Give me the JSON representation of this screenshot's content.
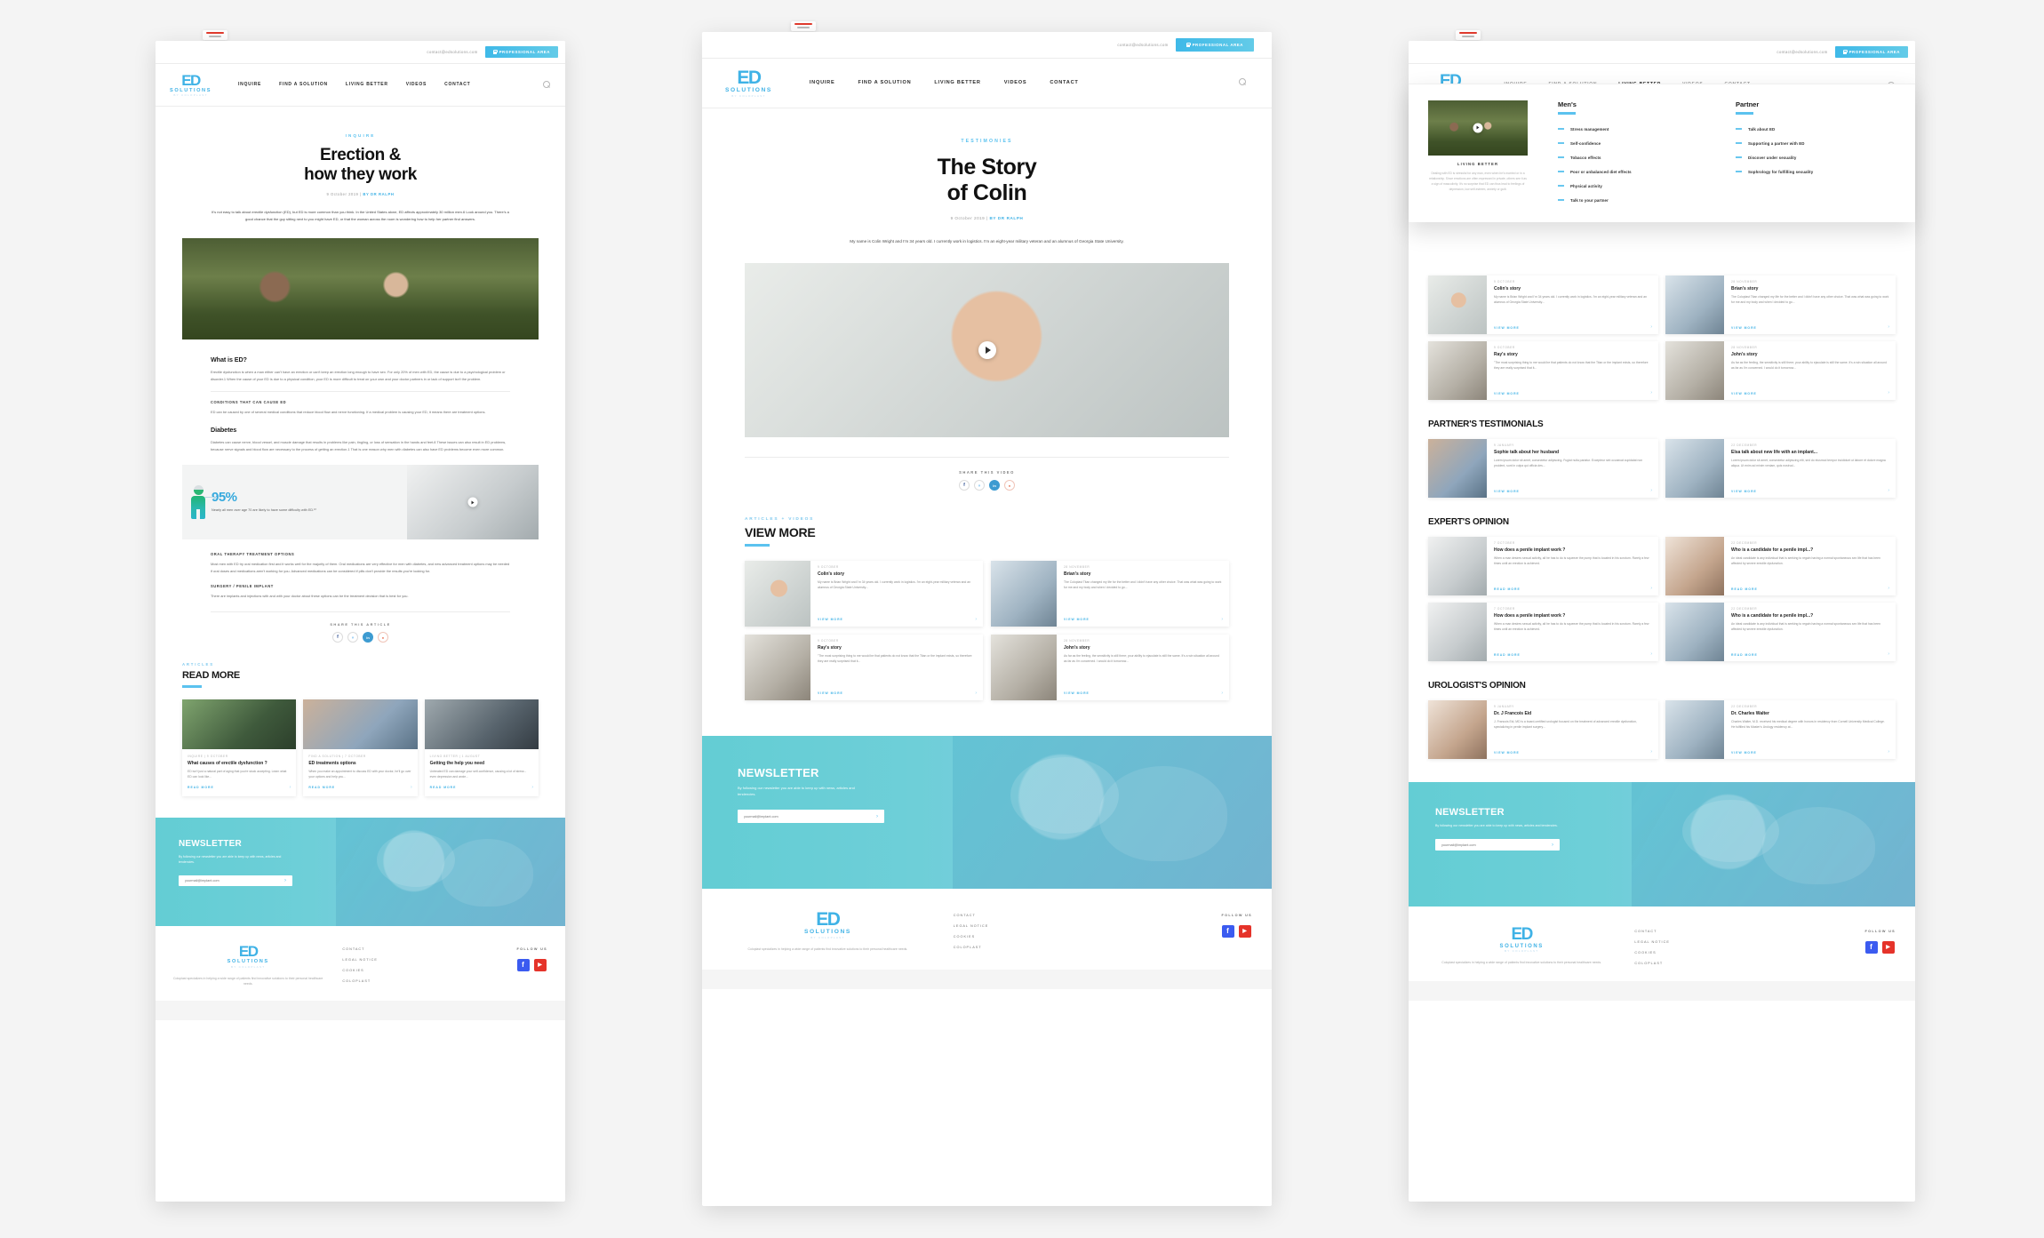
{
  "brand": {
    "mark": "ED",
    "name": "SOLUTIONS",
    "byline": "BY COLOPLAST"
  },
  "topbar": {
    "email": "contact@edsolutions.com",
    "pro_area": "PROFESSIONAL AREA"
  },
  "nav": {
    "items": [
      {
        "label": "INQUIRE"
      },
      {
        "label": "FIND A SOLUTION"
      },
      {
        "label": "LIVING BETTER"
      },
      {
        "label": "VIDEOS"
      },
      {
        "label": "CONTACT"
      }
    ],
    "search_icon": "search-icon"
  },
  "page1": {
    "eyebrow": "INQUIRE",
    "title_line1": "Erection &",
    "title_line2": "how they work",
    "date": "9 October 2019",
    "author": "BY DR RALPH",
    "lead": "It's not easy to talk about erectile dysfunction (ED), but ED is more common than you think. In the United States alone, ED affects approximately 30 million men.6 Look around you. There's a good chance that the guy sitting next to you might have ED, or that the woman across the room is wondering how to help her partner find answers.",
    "s1_title": "What is ED?",
    "s1_body": "Erectile dysfunction is when a man either can't have an erection or can't keep an erection long enough to have sex. For only 20% of men with ED, the cause is due to a psychological problem or disorder.1 When the cause of your ED is due to a physical condition, your ED is more difficult to treat on your own and your doctor partners in or lack of support isn't the problem.",
    "s2_title": "CONDITIONS THAT CAN CAUSE ED",
    "s2_body": "ED can be caused by one of several medical conditions that reduce blood flow and nerve functioning. If a medical problem is causing your ED, it means there are treatment options.",
    "s3_title": "Diabetes",
    "s3_body": "Diabetes can cause nerve, blood vessel, and muscle damage that results in problems like pain, tingling, or loss of sensation in the hands and feet.8 These issues can also result in ED problems, because nerve signals and blood flow are necessary to the process of getting an erection.1 That is one reason why men with diabetes can also have ED problems become even more common.",
    "stat_number": "95%",
    "stat_caption": "Nearly all men over age 70 are likely to have some difficulty with ED.¹⁰",
    "s4_title": "ORAL THERAPY TREATMENT OPTIONS",
    "s4_body": "Most men with ED try oral medication first and it works well for the majority of them. Oral medications are very effective for men with diabetes, and new advanced treatment options may be needed if oral doses and medications aren't working for you. Advanced medications can be considered if pills don't provide the results you're looking for.",
    "s5_title": "SURGERY / PENILE IMPLANT",
    "s5_body": "There are implants and injections with and with your doctor about these options can be the treatment decision that is best for you.",
    "share_label": "SHARE THIS ARTICLE",
    "more_eyebrow": "ARTICLES",
    "more_title": "READ MORE",
    "cards": [
      {
        "meta": "INQUIRE  |  9 OCTOBER",
        "title": "What  causes of erectile dysfunction ?",
        "desc": "ED isn't just a natural part of aging that you're stuck accepting. Learn what ED can look like...",
        "link": "READ MORE",
        "thumb": "couple1"
      },
      {
        "meta": "FIND A SOLUTION  |  7 OCTOBER",
        "title": "ED treatments options",
        "desc": "When you make an appointment to discuss ED with your doctor, he'll go over your options and help you...",
        "link": "READ MORE",
        "thumb": "couple2"
      },
      {
        "meta": "LIVING BETTER  |  1 AUGUST",
        "title": "Getting the help you need",
        "desc": "Untreated ED can damage your self-confidence, causing a lot of stress - even depression and anxie...",
        "link": "READ MORE",
        "thumb": "couple3"
      }
    ]
  },
  "page2": {
    "eyebrow": "TESTIMONIES",
    "title_line1": "The Story",
    "title_line2": "of Colin",
    "date": "9 October 2019",
    "author": "BY DR RALPH",
    "lead": "My name is Colin Wright and I'm 34 years old. I currently work in logistics. I'm an eight-year military veteran and an alumnus of Georgia State University.",
    "share_label": "SHARE THIS VIDEO",
    "more_eyebrow": "ARTICLES + VIDEOS",
    "more_title": "VIEW MORE",
    "cards": [
      {
        "meta": "9 OCTOBER",
        "title": "Colin's story",
        "desc": "My name is Brian Wright and I'm 34 years old. I currently work in logistics. I'm an eight-year military veteran and an alumnus of Georgia State University...",
        "link": "VIEW MORE",
        "thumb": "portrait"
      },
      {
        "meta": "28 NOVEMBER",
        "title": "Brian's story",
        "desc": "The Coloplast Titan changed my life for the better and I didn't have any other choice. That was what was going to work for me and my body and when I decided to go...",
        "link": "VIEW MORE",
        "thumb": "senior-b"
      },
      {
        "meta": "9 OCTOBER",
        "title": "Ray's story",
        "desc": "\"The most surprising thing to me would be that patients do not know that the Titan or the implant exists, so therefore they are really surprised that it...",
        "link": "VIEW MORE",
        "thumb": "senior-a"
      },
      {
        "meta": "28 NOVEMBER",
        "title": "John's story",
        "desc": "As far as the feeling, the sensitivity is still there; your ability to ejaculate is still the same. It's a win situation all around as far as I'm concerned. I would do it tomorrow...",
        "link": "VIEW MORE",
        "thumb": "senior-a"
      }
    ]
  },
  "page3": {
    "megamenu": {
      "feature_caption": "LIVING BETTER",
      "feature_desc": "Dealing with ED is stressful for any man, even when he's married or in a relationship. Since emotions are often expressed in private, others see it as a sign of masculinity. It's no surprise that ED can thus lead to feelings of depression, low self-esteem, anxiety or guilt.",
      "columns": [
        {
          "title": "Men's",
          "items": [
            "Stress management",
            "Self-confidence",
            "Tobacco effects",
            "Poor or unbalanced diet effects",
            "Physical activity",
            "Talk to your partner"
          ]
        },
        {
          "title": "Partner",
          "items": [
            "Talk about ED",
            "Supporting a partner with ED",
            "Discover under sexuality",
            "Sophrology for fulfilling sexuality"
          ]
        }
      ]
    },
    "mens_cards": [
      {
        "meta": "9 OCTOBER",
        "title": "Colin's story",
        "desc": "My name is Brian Wright and I'm 34 years old. I currently work in logistics. I'm an eight-year military veteran and an alumnus of Georgia State University...",
        "link": "VIEW MORE",
        "thumb": "portrait"
      },
      {
        "meta": "28 NOVEMBER",
        "title": "Brian's story",
        "desc": "The Coloplast Titan changed my life for the better and I didn't have any other choice. That was what was going to work for me and my body and when I decided to go...",
        "link": "VIEW MORE",
        "thumb": "senior-b"
      },
      {
        "meta": "9 OCTOBER",
        "title": "Ray's story",
        "desc": "\"The most surprising thing to me would be that patients do not know that the Titan or the implant exists, so therefore they are really surprised that it...",
        "link": "VIEW MORE",
        "thumb": "senior-a"
      },
      {
        "meta": "28 NOVEMBER",
        "title": "John's story",
        "desc": "As far as the feeling, the sensitivity is still there; your ability to ejaculate is still the same. It's a win situation all around as far as I'm concerned. I would do it tomorrow...",
        "link": "VIEW MORE",
        "thumb": "senior-a"
      }
    ],
    "partners_title": "PARTNER'S TESTIMONIALS",
    "partners_cards": [
      {
        "meta": "9 JANUARY",
        "title": "Sophie talk about her husband",
        "desc": "Lorem ipsum dolor sit amet, consectetur adipiscing. Fugiat nulla pariatur. Excepteur sint occaecat cupidatat non proident, sunt in culpa qui officia des...",
        "link": "VIEW MORE",
        "thumb": "couple2"
      },
      {
        "meta": "22 DECEMBER",
        "title": "Elsa talk about new life with an implant...",
        "desc": "Lorem ipsum dolor sit amet, consectetur adipiscing elit, sed do eiusmod tempor incididunt ut labore et dolore magna aliqua. Ut enim ad minim veniam, quis nostrud...",
        "link": "VIEW MORE",
        "thumb": "senior-b"
      }
    ],
    "experts_title": "EXPERT'S OPINION",
    "experts_cards": [
      {
        "meta": "7 OCTOBER",
        "title": "How does a penile implant work ?",
        "desc": "When a man desires sexual activity, all he has to do is squeeze the pump that is located in his scrotum. Rarely a few times until an erection is achieved.",
        "link": "READ MORE",
        "thumb": "office"
      },
      {
        "meta": "22 DECEMBER",
        "title": "Who is a candidate for a penile impl...?",
        "desc": "An ideal candidate is any individual that is seeking to regain having a normal spontaneous sex life that has been affected by severe erectile dysfunction.",
        "link": "READ MORE",
        "thumb": "woman"
      },
      {
        "meta": "7 OCTOBER",
        "title": "How does a penile implant work ?",
        "desc": "When a man desires sexual activity, all he has to do is squeeze the pump that is located in his scrotum. Rarely a few times until an erection is achieved.",
        "link": "READ MORE",
        "thumb": "office"
      },
      {
        "meta": "22 DECEMBER",
        "title": "Who is a candidate for a penile impl...?",
        "desc": "An ideal candidate is any individual that is seeking to regain having a normal spontaneous sex life that has been affected by severe erectile dysfunction.",
        "link": "READ MORE",
        "thumb": "senior-b"
      }
    ],
    "urologists_title": "UROLOGIST'S OPINION",
    "urologists_cards": [
      {
        "meta": "9 JANUARY",
        "title": "Dr. J Francois Eid",
        "desc": "J. Francois Eid, MD is a board-certified urologist focused on the treatment of advanced erectile dysfunction, specializing in penile implant surgery...",
        "link": "VIEW MORE",
        "thumb": "woman"
      },
      {
        "meta": "22 DECEMBER",
        "title": "Dr. Charles Walter",
        "desc": "Charles Walter, M.D. received his medical degree with honors in residency from Cornell University Medical College. He fulfilled his Master's Urology residency at...",
        "link": "VIEW MORE",
        "thumb": "senior-b"
      }
    ]
  },
  "newsletter": {
    "title": "NEWSLETTER",
    "subtitle": "By following our newsletter you are able to keep up with news, articles and tendencies.",
    "placeholder": "yourmail@implant.com",
    "submit_icon": "arrow-right-icon"
  },
  "footer": {
    "about": "Coloplast specializes in helping a wide range of patients find innovative solutions to their personal healthcare needs.",
    "links": [
      "CONTACT",
      "LEGAL NOTICE",
      "COOKIES",
      "COLOPLAST"
    ],
    "follow_label": "FOLLOW US",
    "social": [
      {
        "name": "facebook-icon",
        "glyph": "f",
        "color": "#3b5bf0"
      },
      {
        "name": "youtube-icon",
        "glyph": "▶",
        "color": "#e5332a"
      }
    ]
  },
  "share_icons": [
    {
      "name": "facebook-icon",
      "glyph": "f"
    },
    {
      "name": "twitter-icon",
      "glyph": "ᵥ"
    },
    {
      "name": "linkedin-icon",
      "glyph": "in"
    },
    {
      "name": "pinterest-icon",
      "glyph": "●"
    }
  ]
}
